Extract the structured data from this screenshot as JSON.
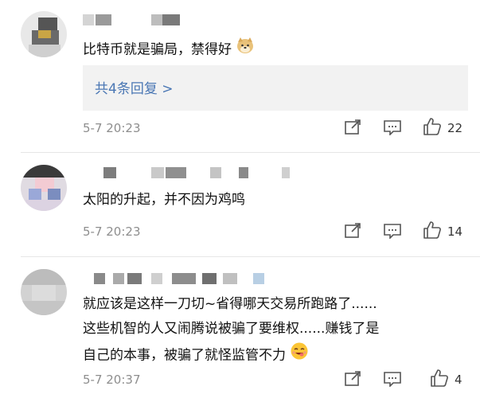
{
  "comments": [
    {
      "text": "比特币就是骗局，禁得好",
      "emoji": "dog-face-emoji",
      "reply_link": "共4条回复 >",
      "time": "5-7 20:23",
      "likes": "22"
    },
    {
      "text": "太阳的升起，并不因为鸡鸣",
      "time": "5-7 20:23",
      "likes": "14"
    },
    {
      "lines": [
        "就应该是这样一刀切~省得哪天交易所跑路了......",
        "这些机智的人又闹腾说被骗了要维权......赚钱了是",
        "自己的本事，被骗了就怪监管不力"
      ],
      "emoji": "yummy-face-emoji",
      "time": "5-7 20:37",
      "likes": "4"
    }
  ],
  "icons": {
    "share": "share-icon",
    "comment": "comment-icon",
    "like": "thumbs-up-icon"
  },
  "colors": {
    "link": "#4a77b4",
    "meta": "#8e8e8e",
    "reply_bg": "#f2f2f2"
  }
}
